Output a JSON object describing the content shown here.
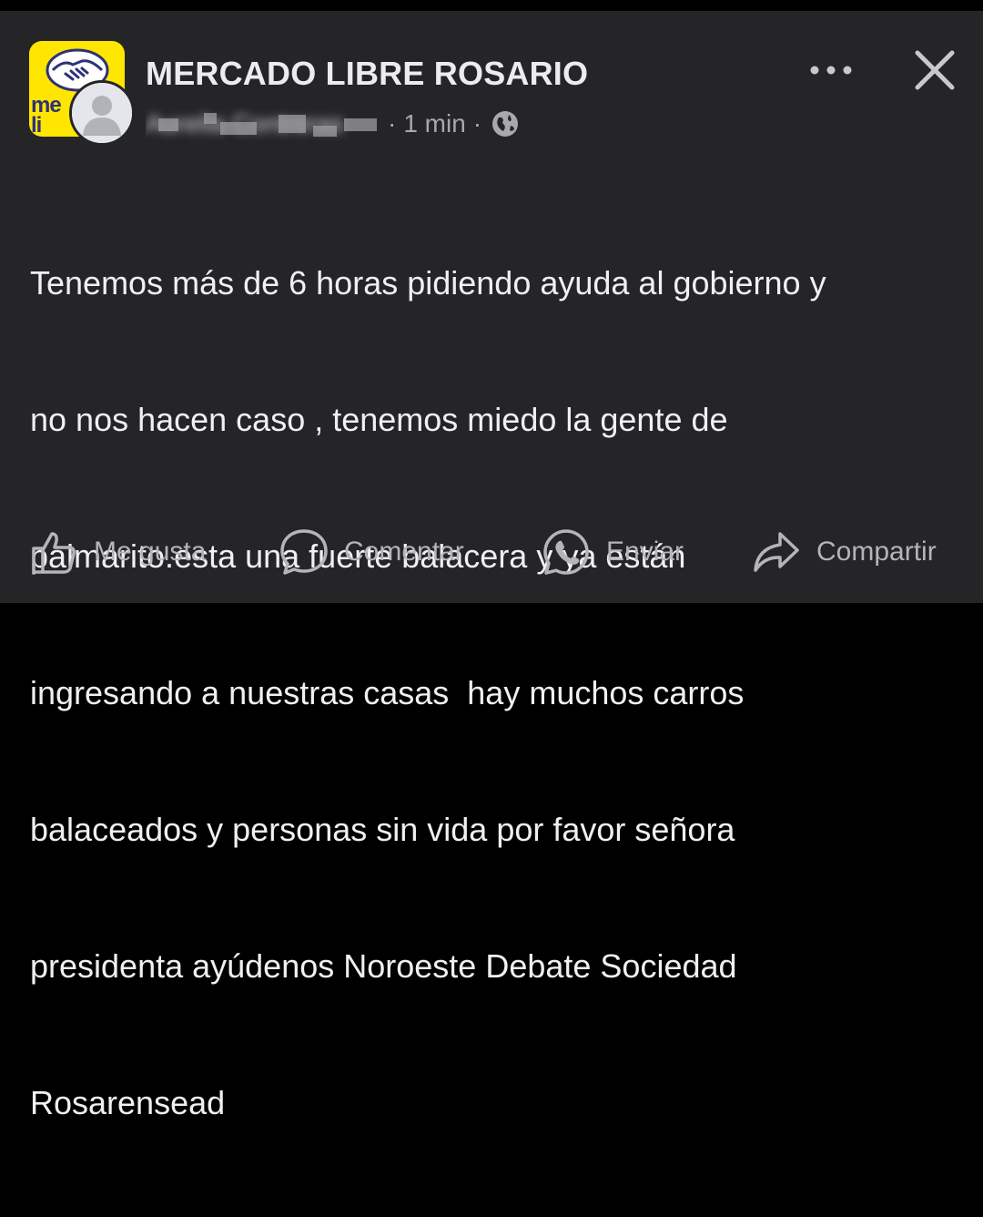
{
  "colors": {
    "card_background": "#252527",
    "page_background": "#000000",
    "text_primary": "#f0f0f2",
    "text_secondary": "#a8a8ad",
    "brand_yellow": "#ffe600",
    "brand_blue": "#2d3277"
  },
  "header": {
    "group_name": "MERCADO LIBRE ROSARIO",
    "group_logo_text": "mercado libre",
    "group_logo_text_visible": "me\nli",
    "author_name_blurred": "Aurelia Contreras",
    "separator": "·",
    "time": "1 min",
    "privacy_icon": "globe-icon",
    "more_icon": "more-horizontal-icon",
    "close_icon": "close-icon"
  },
  "post": {
    "text_lines": [
      "Tenemos más de 6 horas pidiendo ayuda al gobierno y",
      "no nos hacen caso , tenemos miedo la gente de",
      "palmarito.esta una fuerte balacera y ya están",
      "ingresando a nuestras casas  hay muchos carros",
      "balaceados y personas sin vida por favor señora",
      "presidenta ayúdenos Noroeste Debate Sociedad",
      "Rosarensead"
    ]
  },
  "actions": {
    "like": {
      "label": "Me gusta",
      "icon": "thumbs-up-icon"
    },
    "comment": {
      "label": "Comentar",
      "icon": "comment-bubble-icon"
    },
    "send": {
      "label": "Enviar",
      "icon": "whatsapp-icon"
    },
    "share": {
      "label": "Compartir",
      "icon": "share-arrow-icon"
    }
  }
}
